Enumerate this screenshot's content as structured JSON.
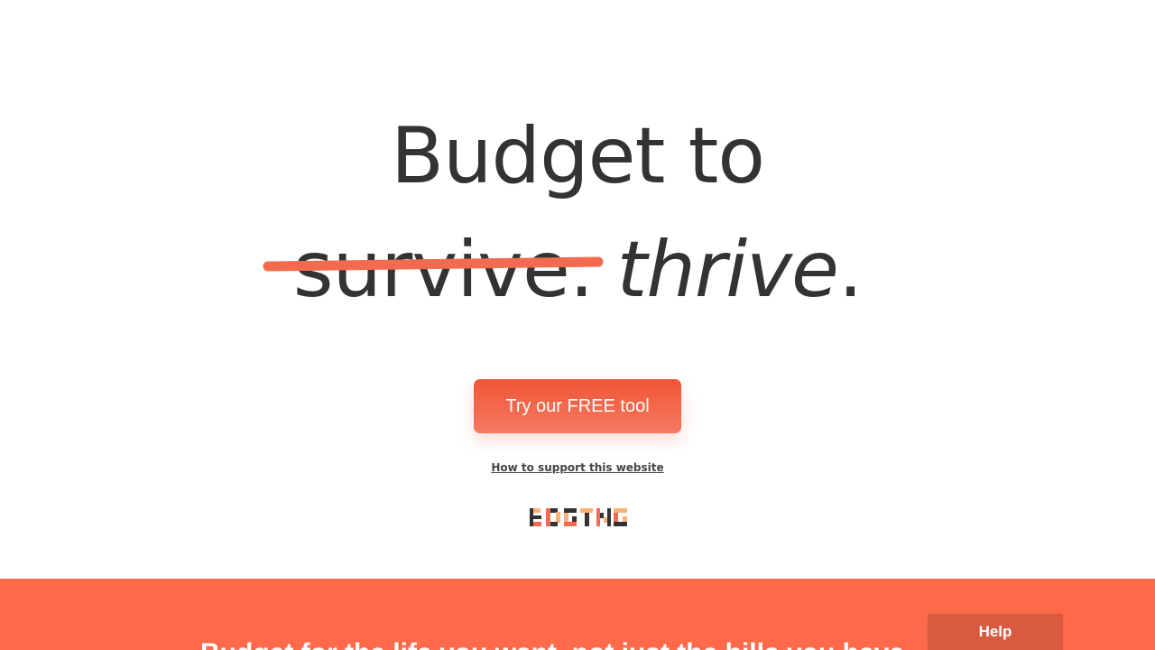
{
  "hero": {
    "line1": "Budget to",
    "struck_word": "survive.",
    "replacement_word": "thrive",
    "end_punct": "."
  },
  "cta": {
    "label": "Try our FREE tool"
  },
  "support_link": {
    "label": "How to support this website"
  },
  "logo": {
    "text": "BDGTNG"
  },
  "band": {
    "text": "Budget for the life you want, not just the bills you have."
  },
  "help": {
    "label": "Help"
  },
  "colors": {
    "accent": "#ff6b4a",
    "strike": "#f26b50",
    "button_top": "#f25535",
    "button_bottom": "#f47a62",
    "text": "#333333",
    "help_bg": "#d95a40"
  }
}
